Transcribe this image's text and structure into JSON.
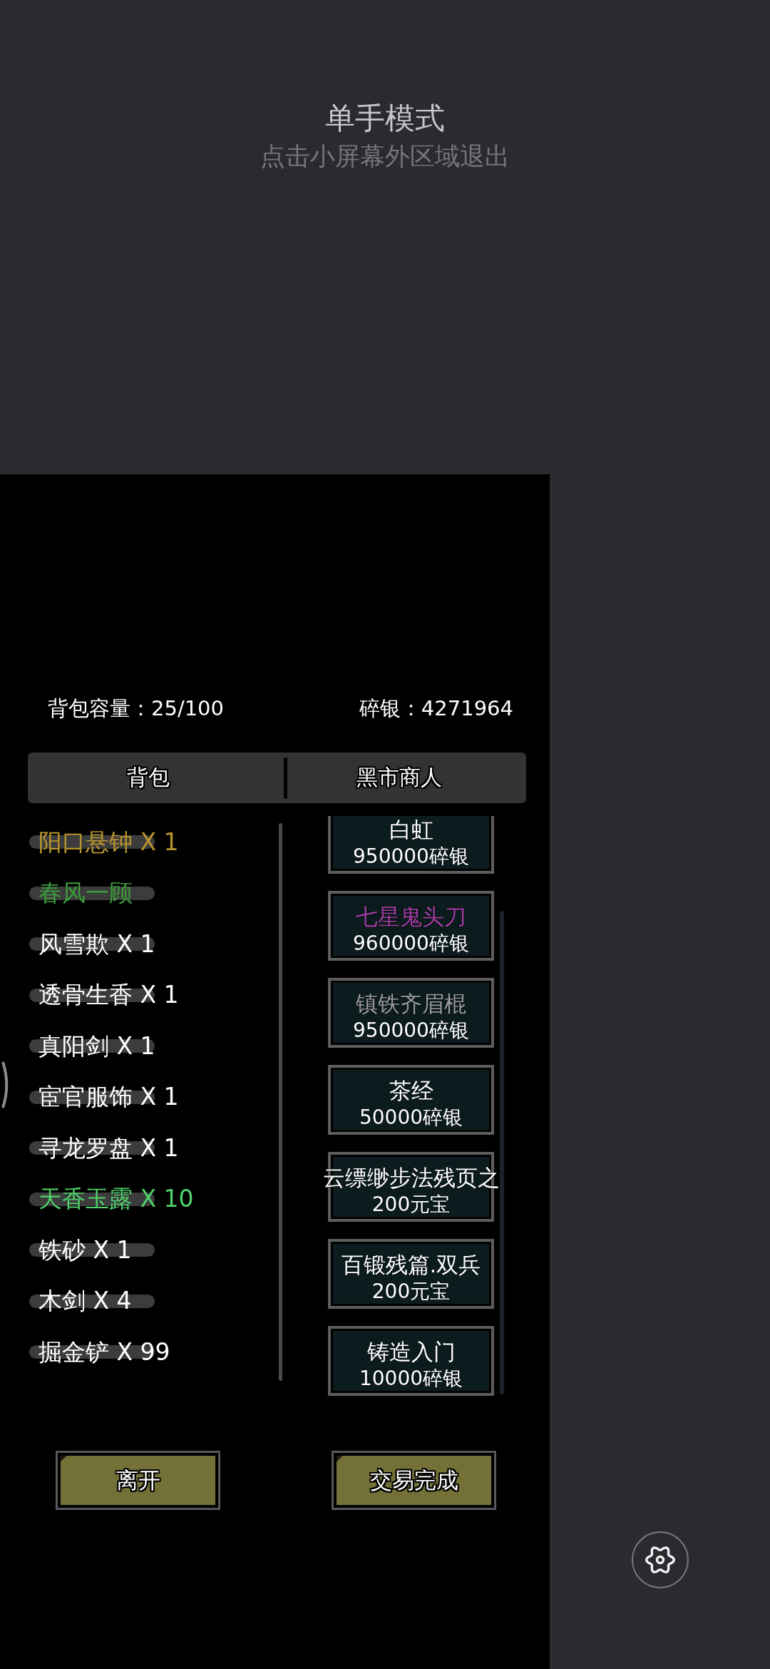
{
  "one_hand_mode": {
    "title": "单手模式",
    "hint": "点击小屏幕外区域退出"
  },
  "status": {
    "bag_capacity": "背包容量：25/100",
    "money": "碎银：4271964"
  },
  "tabs": [
    {
      "label": "背包"
    },
    {
      "label": "黑市商人"
    }
  ],
  "inventory": [
    {
      "label": "阳口悬钟 X 1",
      "color": "#b8952c"
    },
    {
      "label": "春风一顾",
      "color": "#3c9c3c"
    },
    {
      "label": "风雪欺 X 1",
      "color": "#ffffff"
    },
    {
      "label": "透骨生香 X 1",
      "color": "#ffffff"
    },
    {
      "label": "真阳剑 X 1",
      "color": "#ffffff"
    },
    {
      "label": "宦官服饰 X 1",
      "color": "#ffffff"
    },
    {
      "label": "寻龙罗盘 X 1",
      "color": "#ffffff"
    },
    {
      "label": "天香玉露 X 10",
      "color": "#4fd36a"
    },
    {
      "label": "铁砂 X 1",
      "color": "#ffffff"
    },
    {
      "label": "木剑 X 4",
      "color": "#ffffff"
    },
    {
      "label": "掘金铲 X 99",
      "color": "#ffffff"
    }
  ],
  "merchant_goods": [
    {
      "name": "白虹",
      "price": "950000碎银",
      "color": "#ffffff"
    },
    {
      "name": "七星鬼头刀",
      "price": "960000碎银",
      "color": "#a33ea3"
    },
    {
      "name": "镇铁齐眉棍",
      "price": "950000碎银",
      "color": "#9b9b9b"
    },
    {
      "name": "茶经",
      "price": "50000碎银",
      "color": "#ffffff"
    },
    {
      "name": "云缥缈步法残页之",
      "price": "200元宝",
      "color": "#ffffff"
    },
    {
      "name": "百锻残篇.双兵",
      "price": "200元宝",
      "color": "#ffffff"
    },
    {
      "name": "铸造入门",
      "price": "10000碎银",
      "color": "#ffffff"
    }
  ],
  "buttons": [
    "离开",
    "交易完成"
  ]
}
